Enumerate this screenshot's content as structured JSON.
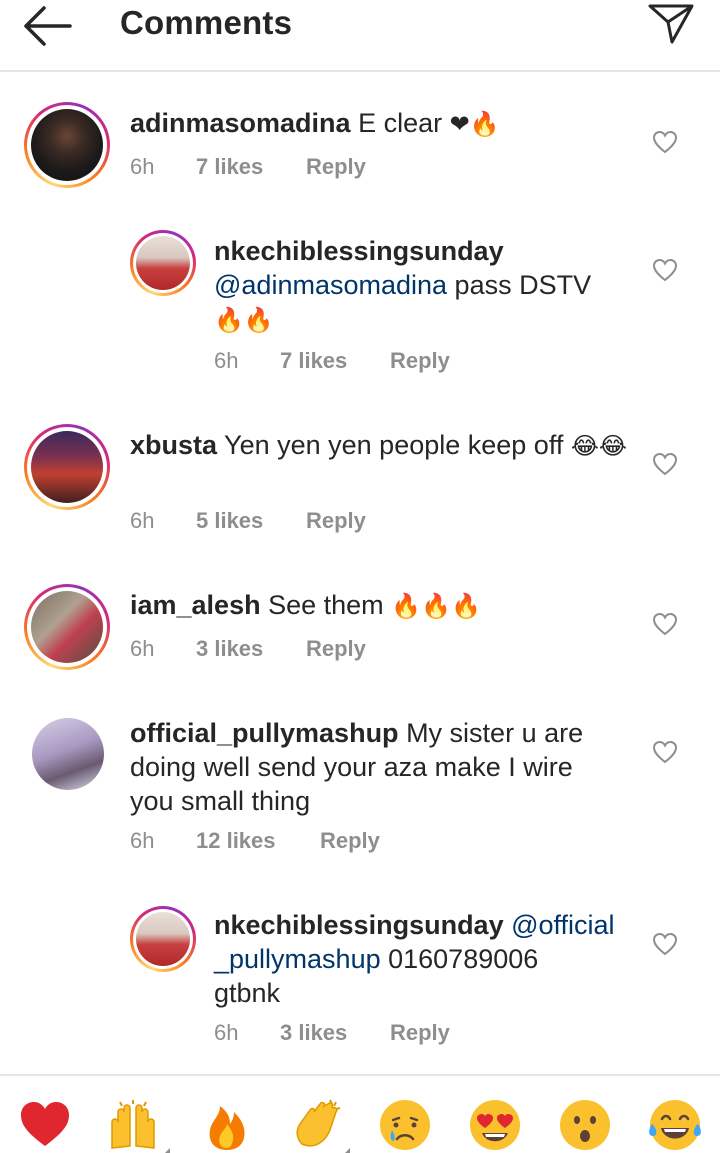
{
  "header": {
    "title": "Comments"
  },
  "comments": [
    {
      "username": "adinmasomadina",
      "text": " E clear ",
      "emojis": "❤🔥",
      "time": "6h",
      "likes": "7 likes",
      "reply": "Reply"
    },
    {
      "username": "nkechiblessingsunday",
      "mention": "@adinmasomadina",
      "text": " pass DSTV",
      "emojis": "🔥🔥",
      "time": "6h",
      "likes": "7 likes",
      "reply": "Reply"
    },
    {
      "username": "xbusta",
      "text": " Yen yen yen people keep off ",
      "emojis": "😂😂",
      "time": "6h",
      "likes": "5 likes",
      "reply": "Reply"
    },
    {
      "username": "iam_alesh",
      "text": " See them ",
      "emojis": "🔥🔥🔥",
      "time": "6h",
      "likes": "3 likes",
      "reply": "Reply"
    },
    {
      "username": "official_pullymashup",
      "line1": " My sister u are",
      "line2": "doing well send your aza make I wire",
      "line3": "you small thing",
      "time": "6h",
      "likes": "12 likes",
      "reply": "Reply"
    },
    {
      "username": "nkechiblessingsunday",
      "mention1": " @official",
      "mention2": "_pullymashup",
      "text": " 0160789006",
      "line3": "gtbnk",
      "time": "6h",
      "likes": "3 likes",
      "reply": "Reply"
    }
  ],
  "reactions": [
    "heart",
    "raising-hands",
    "fire",
    "clapping-hands",
    "crying-face",
    "heart-eyes",
    "surprised-face",
    "tears-of-joy"
  ],
  "colors": {
    "mention": "#003569",
    "meta": "#8e8e8e",
    "text": "#262626",
    "heart": "#e0262e",
    "fire": "#f57c00"
  }
}
